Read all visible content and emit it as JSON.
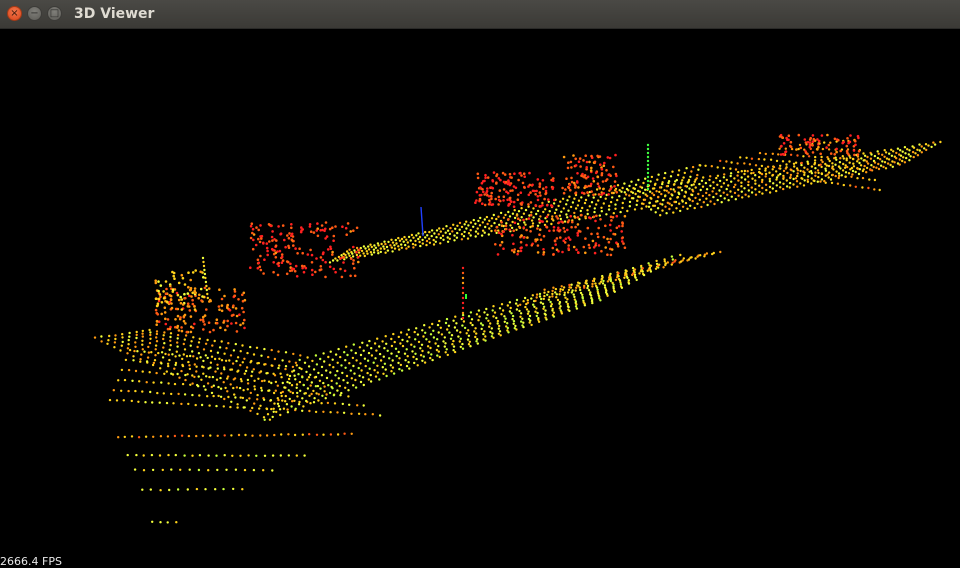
{
  "window": {
    "title": "3D Viewer",
    "buttons": {
      "close": "×",
      "minimize": "−",
      "maximize": "□"
    }
  },
  "viewer": {
    "fps_label": "2666.4 FPS",
    "background": "#000000",
    "point_colors": [
      "#ff2020",
      "#ff5a14",
      "#ff9a10",
      "#ffd21a",
      "#f2ff3a",
      "#c8ff3a",
      "#40ff40"
    ],
    "axis_colors": {
      "x": "#ff2020",
      "y": "#30ff30",
      "z": "#2040ff"
    }
  }
}
